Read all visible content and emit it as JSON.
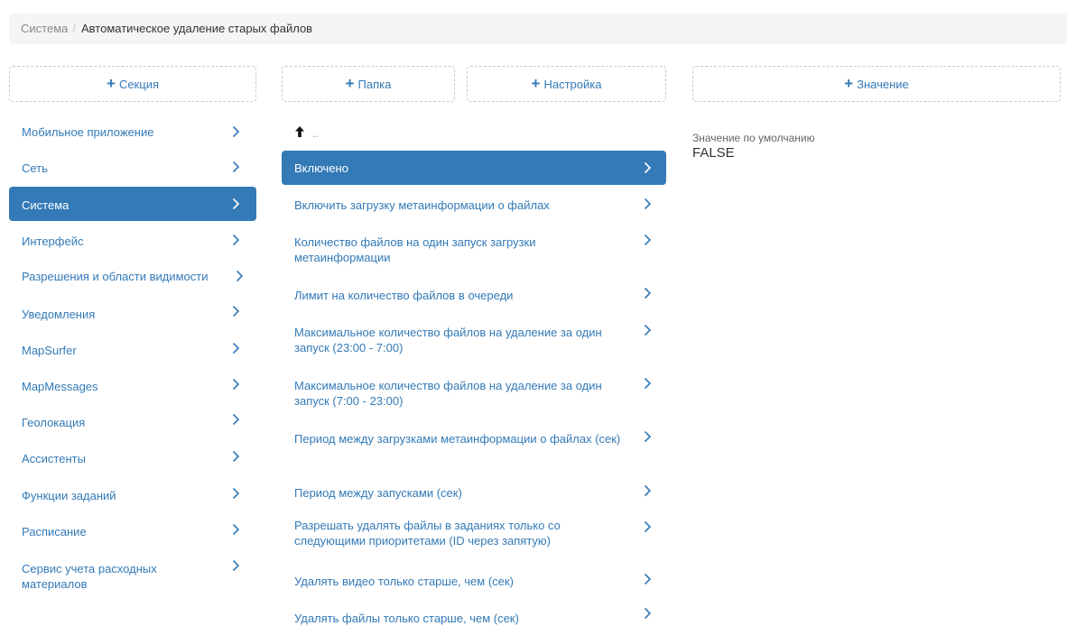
{
  "breadcrumb": {
    "root": "Система",
    "separator": "/",
    "current": "Автоматическое удаление старых файлов"
  },
  "buttons": {
    "add_section": "Секция",
    "add_folder": "Папка",
    "add_setting": "Настройка",
    "add_value": "Значение"
  },
  "sections": [
    {
      "label": "Мобильное приложение",
      "selected": false
    },
    {
      "label": "Сеть",
      "selected": false
    },
    {
      "label": "Система",
      "selected": true
    },
    {
      "label": "Интерфейс",
      "selected": false
    },
    {
      "label": "Разрешения и области видимости",
      "selected": false
    },
    {
      "label": "Уведомления",
      "selected": false
    },
    {
      "label": "MapSurfer",
      "selected": false
    },
    {
      "label": "MapMessages",
      "selected": false
    },
    {
      "label": "Геолокация",
      "selected": false
    },
    {
      "label": "Ассистенты",
      "selected": false
    },
    {
      "label": "Функции заданий",
      "selected": false
    },
    {
      "label": "Расписание",
      "selected": false
    },
    {
      "label": "Сервис учета расходных материалов",
      "selected": false
    }
  ],
  "settings": {
    "up_label": "..",
    "items": [
      {
        "label": "Включено",
        "selected": true
      },
      {
        "label": "Включить загрузку метаинформации о файлах",
        "selected": false
      },
      {
        "label": "Количество файлов на один запуск загрузки метаинформации",
        "selected": false
      },
      {
        "label": "Лимит на количество файлов в очереди",
        "selected": false
      },
      {
        "label": "Максимальное количество файлов на удаление за один запуск (23:00 - 7:00)",
        "selected": false
      },
      {
        "label": "Максимальное количество файлов на удаление за один запуск (7:00 - 23:00)",
        "selected": false
      },
      {
        "label": "Период между загрузками метаинформации о файлах (сек)",
        "selected": false
      },
      {
        "label": "Период между запусками (сек)",
        "selected": false
      },
      {
        "label": "Разрешать удалять файлы в заданиях только со следующими приоритетами (ID через запятую)",
        "selected": false
      },
      {
        "label": "Удалять видео только старше, чем (сек)",
        "selected": false
      },
      {
        "label": "Удалять файлы только старше, чем (сек)",
        "selected": false
      }
    ]
  },
  "value_panel": {
    "label": "Значение по умолчанию",
    "value": "FALSE"
  },
  "colors": {
    "accent": "#337ab7",
    "selected_bg": "#337ab7",
    "breadcrumb_bg": "#f5f5f5"
  }
}
